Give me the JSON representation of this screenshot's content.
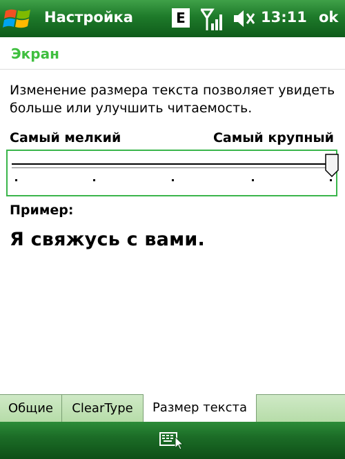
{
  "titlebar": {
    "title": "Настройка",
    "network_badge": "E",
    "clock": "13:11",
    "ok_label": "ok"
  },
  "section": {
    "title": "Экран",
    "description": "Изменение размера текста позволяет увидеть больше или улучшить читаемость."
  },
  "slider": {
    "min_label": "Самый мелкий",
    "max_label": "Самый крупный",
    "steps": 5,
    "value_step": 5
  },
  "example": {
    "label": "Пример:",
    "text": "Я свяжусь с вами."
  },
  "tabs": [
    {
      "label": "Общие",
      "active": false
    },
    {
      "label": "ClearType",
      "active": false
    },
    {
      "label": "Размер текста",
      "active": true
    }
  ],
  "colors": {
    "accent_green": "#3fbf3f",
    "bar_green": "#1e7a2a"
  }
}
